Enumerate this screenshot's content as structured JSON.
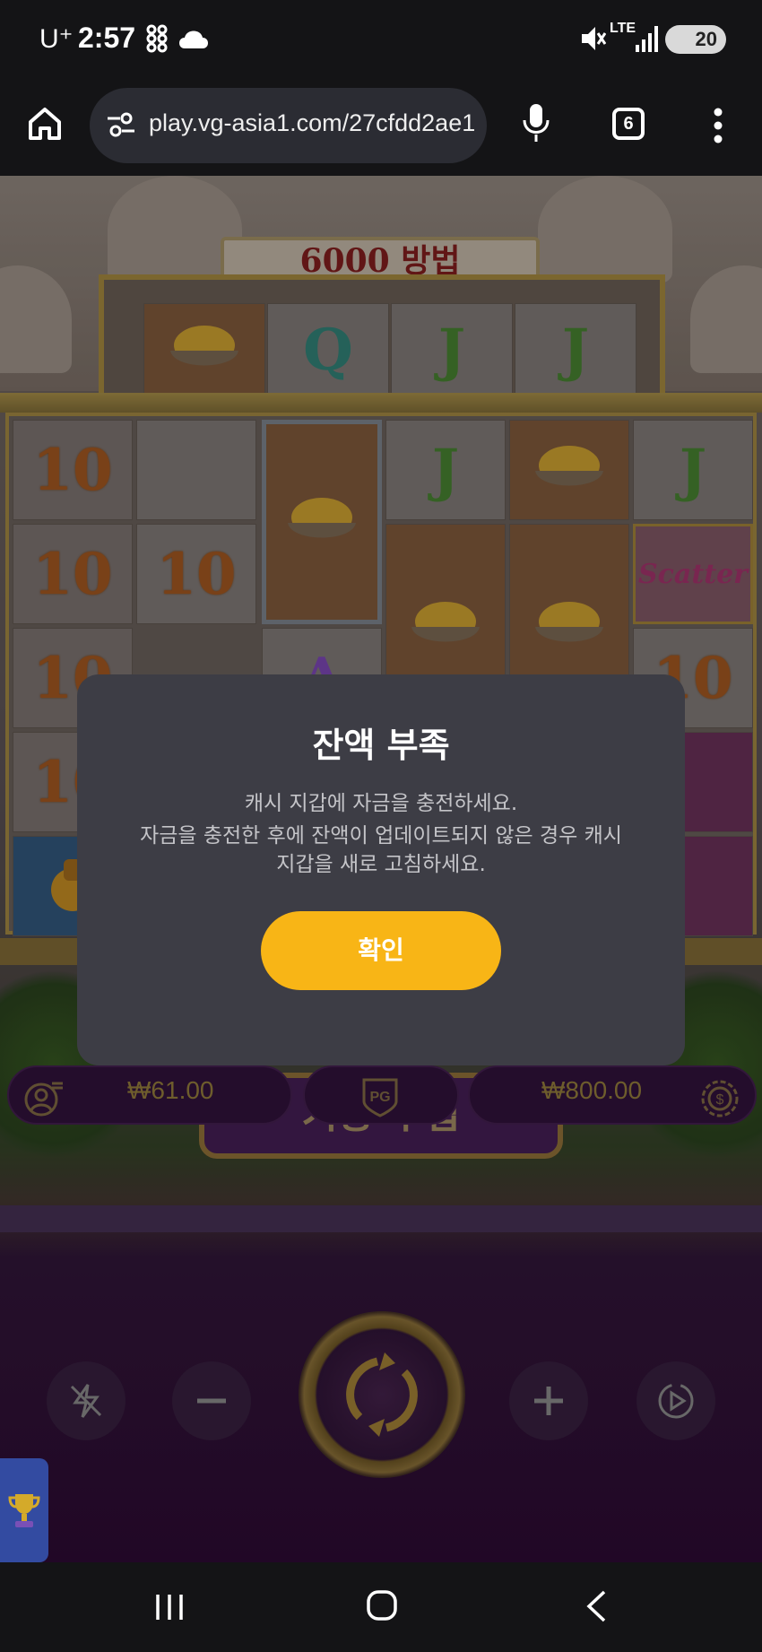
{
  "status_bar": {
    "carrier": "U⁺",
    "time": "2:57",
    "network": "LTE",
    "battery": "20"
  },
  "browser": {
    "url": "play.vg-asia1.com/27cfdd2ae1",
    "tab_count": "6"
  },
  "game": {
    "ways_banner": "6000 방법",
    "scatter_label": "Scatter",
    "top_row_symbols": [
      "bowl",
      "Q",
      "J",
      "J"
    ],
    "reel_symbols": {
      "ten": "10",
      "j": "J",
      "a": "A"
    },
    "buy_feature_label": "기능 구입",
    "win_amount": "₩61.00",
    "bet_amount": "₩800.00",
    "provider_badge": "PG"
  },
  "dialog": {
    "title": "잔액 부족",
    "message_line1": "캐시 지갑에 자금을 충전하세요.",
    "message_line2": "자금을 충전한 후에 잔액이 업데이트되지 않은 경우 캐시",
    "message_line3": "지갑을 새로 고침하세요.",
    "confirm_label": "확인"
  },
  "colors": {
    "confirm_button": "#f8b516",
    "dialog_bg": "#3d3d45",
    "gold_text": "#7e6a33"
  }
}
